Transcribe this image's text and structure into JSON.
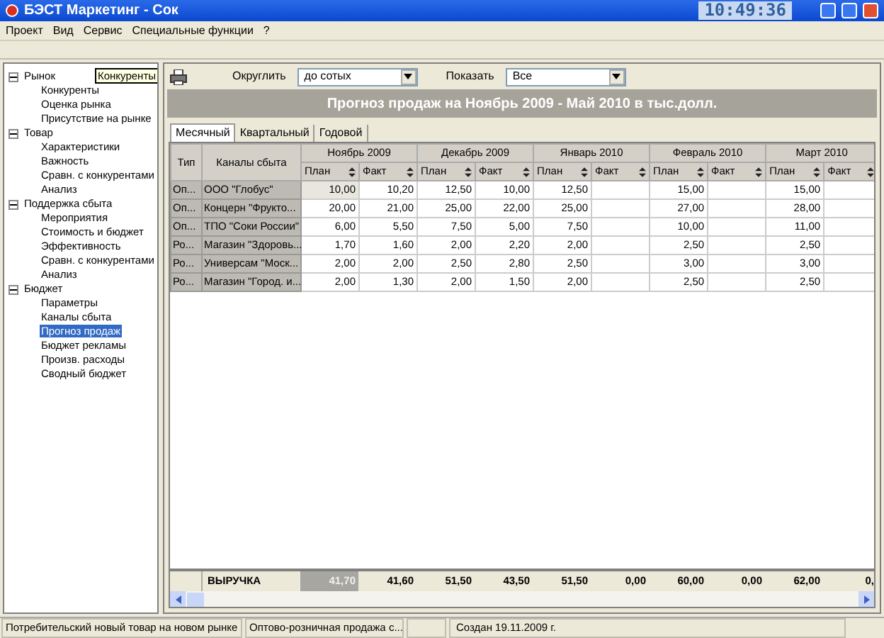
{
  "window": {
    "title": "БЭСТ Маркетинг - Сок",
    "clock": "10:49:36"
  },
  "menu": [
    "Проект",
    "Вид",
    "Сервис",
    "Специальные функции",
    "?"
  ],
  "tree": [
    {
      "label": "Рынок",
      "expanded": true,
      "children": [
        {
          "label": "Конкуренты",
          "selected": false
        },
        {
          "label": "Оценка рынка",
          "selected": false
        },
        {
          "label": "Присутствие на рынке",
          "selected": false
        }
      ]
    },
    {
      "label": "Товар",
      "expanded": true,
      "children": [
        {
          "label": "Характеристики",
          "selected": false
        },
        {
          "label": "Важность",
          "selected": false
        },
        {
          "label": "Сравн. с конкурентами",
          "selected": false
        },
        {
          "label": "Анализ",
          "selected": false
        }
      ]
    },
    {
      "label": "Поддержка сбыта",
      "expanded": true,
      "children": [
        {
          "label": "Мероприятия",
          "selected": false
        },
        {
          "label": "Стоимость и бюджет",
          "selected": false
        },
        {
          "label": "Эффективность",
          "selected": false
        },
        {
          "label": "Сравн. с конкурентами",
          "selected": false
        },
        {
          "label": "Анализ",
          "selected": false
        }
      ]
    },
    {
      "label": "Бюджет",
      "expanded": true,
      "children": [
        {
          "label": "Параметры",
          "selected": false
        },
        {
          "label": "Каналы сбыта",
          "selected": false
        },
        {
          "label": "Прогноз продаж",
          "selected": true
        },
        {
          "label": "Бюджет рекламы",
          "selected": false
        },
        {
          "label": "Произв. расходы",
          "selected": false
        },
        {
          "label": "Сводный бюджет",
          "selected": false
        }
      ]
    }
  ],
  "tooltip": "Конкуренты",
  "toolbar": {
    "round_label": "Округлить",
    "round_value": "до сотых",
    "show_label": "Показать",
    "show_value": "Все"
  },
  "banner": "Прогноз продаж на Ноябрь 2009 - Май 2010 в тыс.долл.",
  "tabs": [
    {
      "label": "Месячный",
      "selected": true
    },
    {
      "label": "Квартальный",
      "selected": false
    },
    {
      "label": "Годовой",
      "selected": false
    }
  ],
  "table": {
    "type_header": "Тип",
    "channel_header": "Каналы сбыта",
    "months": [
      {
        "name": "Ноябрь 2009",
        "plan": "План",
        "fact": "Факт"
      },
      {
        "name": "Декабрь 2009",
        "plan": "План",
        "fact": "Факт"
      },
      {
        "name": "Январь 2010",
        "plan": "План",
        "fact": "Факт"
      },
      {
        "name": "Февраль 2010",
        "plan": "План",
        "fact": "Факт"
      },
      {
        "name": "Март 2010",
        "plan": "План",
        "fact": "Факт"
      }
    ],
    "rows": [
      {
        "type": "Оп...",
        "channel": "ООО \"Глобус\"",
        "first_cell_selected": true,
        "cells": [
          {
            "plan": "10,00",
            "fact": "10,20"
          },
          {
            "plan": "12,50",
            "fact": "10,00"
          },
          {
            "plan": "12,50"
          },
          {
            "plan": "15,00"
          },
          {
            "plan": "15,00"
          }
        ]
      },
      {
        "type": "Оп...",
        "channel": "Концерн \"Фрукто...",
        "first_cell_selected": false,
        "cells": [
          {
            "plan": "20,00",
            "fact": "21,00"
          },
          {
            "plan": "25,00",
            "fact": "22,00"
          },
          {
            "plan": "25,00"
          },
          {
            "plan": "27,00"
          },
          {
            "plan": "28,00"
          }
        ]
      },
      {
        "type": "Оп...",
        "channel": "ТПО \"Соки России\"",
        "first_cell_selected": false,
        "cells": [
          {
            "plan": "6,00",
            "fact": "5,50"
          },
          {
            "plan": "7,50",
            "fact": "5,00"
          },
          {
            "plan": "7,50"
          },
          {
            "plan": "10,00"
          },
          {
            "plan": "11,00"
          }
        ]
      },
      {
        "type": "Ро...",
        "channel": "Магазин \"Здоровь...",
        "first_cell_selected": false,
        "cells": [
          {
            "plan": "1,70",
            "fact": "1,60"
          },
          {
            "plan": "2,00",
            "fact": "2,20"
          },
          {
            "plan": "2,00"
          },
          {
            "plan": "2,50"
          },
          {
            "plan": "2,50"
          }
        ]
      },
      {
        "type": "Ро...",
        "channel": "Универсам \"Моск...",
        "first_cell_selected": false,
        "cells": [
          {
            "plan": "2,00",
            "fact": "2,00"
          },
          {
            "plan": "2,50",
            "fact": "2,80"
          },
          {
            "plan": "2,50"
          },
          {
            "plan": "3,00"
          },
          {
            "plan": "3,00"
          }
        ]
      },
      {
        "type": "Ро...",
        "channel": "Магазин \"Город. и...",
        "first_cell_selected": false,
        "cells": [
          {
            "plan": "2,00",
            "fact": "1,30"
          },
          {
            "plan": "2,00",
            "fact": "1,50"
          },
          {
            "plan": "2,00"
          },
          {
            "plan": "2,50"
          },
          {
            "plan": "2,50"
          }
        ]
      }
    ],
    "total": {
      "label": "ВЫРУЧКА",
      "first_cell_selected": true,
      "values": [
        "41,70",
        "41,60",
        "51,50",
        "43,50",
        "51,50",
        "0,00",
        "60,00",
        "0,00",
        "62,00",
        "0,"
      ]
    }
  },
  "status_bar": [
    "Потребительский новый товар на новом рынке",
    "Оптово-розничная продажа с...",
    "Создан 19.11.2009 г."
  ]
}
